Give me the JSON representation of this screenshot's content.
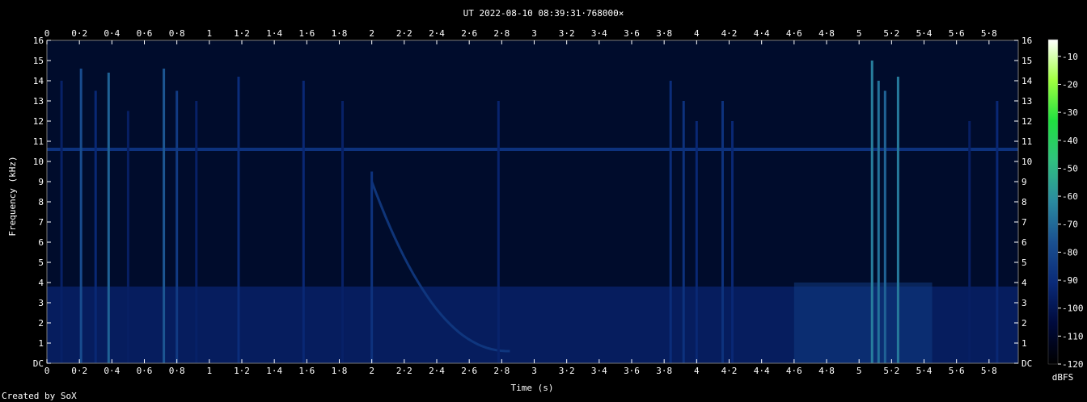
{
  "chart_data": {
    "type": "heatmap",
    "title": "UT 2022-08-10 08:39:31·768000×",
    "xlabel": "Time (s)",
    "ylabel": "Frequency (kHz)",
    "xlim": [
      0,
      5.98
    ],
    "ylim": [
      0,
      16
    ],
    "x_ticks": [
      "0",
      "0·2",
      "0·4",
      "0·6",
      "0·8",
      "1",
      "1·2",
      "1·4",
      "1·6",
      "1·8",
      "2",
      "2·2",
      "2·4",
      "2·6",
      "2·8",
      "3",
      "3·2",
      "3·4",
      "3·6",
      "3·8",
      "4",
      "4·2",
      "4·4",
      "4·6",
      "4·8",
      "5",
      "5·2",
      "5·4",
      "5·6",
      "5·8"
    ],
    "y_ticks": [
      "DC",
      "1",
      "2",
      "3",
      "4",
      "5",
      "6",
      "7",
      "8",
      "9",
      "10",
      "11",
      "12",
      "13",
      "14",
      "15",
      "16"
    ],
    "colorbar": {
      "label": "dBFS",
      "ticks": [
        "-10",
        "-20",
        "-30",
        "-40",
        "-50",
        "-60",
        "-70",
        "-80",
        "-90",
        "-100",
        "-110",
        "-120"
      ],
      "range": [
        -120,
        -4
      ],
      "colors": [
        "#000000",
        "#000a3c",
        "#0a2a78",
        "#1a5090",
        "#2a8aa0",
        "#30c080",
        "#20e040",
        "#a0ff40",
        "#ffffff"
      ]
    },
    "background_level_db": -105,
    "features": [
      {
        "kind": "constant_tone",
        "freq_khz": 10.6,
        "level_db": -88
      },
      {
        "kind": "low_band_energy",
        "freq_range_khz": [
          0,
          3.8
        ],
        "level_db": -95
      },
      {
        "kind": "descending_sweep",
        "t_start": 2.0,
        "t_end": 2.85,
        "f_start_khz": 9.0,
        "f_end_khz": 0.6,
        "level_db": -85
      },
      {
        "kind": "broadband_patch",
        "t_range": [
          4.6,
          5.45
        ],
        "freq_range_khz": [
          0,
          4.0
        ],
        "level_db": -85
      }
    ],
    "impulses": [
      {
        "t": 0.09,
        "fmax_khz": 14.0,
        "level_db": -95
      },
      {
        "t": 0.21,
        "fmax_khz": 14.6,
        "level_db": -78
      },
      {
        "t": 0.3,
        "fmax_khz": 13.5,
        "level_db": -92
      },
      {
        "t": 0.38,
        "fmax_khz": 14.4,
        "level_db": -72
      },
      {
        "t": 0.5,
        "fmax_khz": 12.5,
        "level_db": -96
      },
      {
        "t": 0.72,
        "fmax_khz": 14.6,
        "level_db": -75
      },
      {
        "t": 0.8,
        "fmax_khz": 13.5,
        "level_db": -85
      },
      {
        "t": 0.92,
        "fmax_khz": 13.0,
        "level_db": -95
      },
      {
        "t": 1.18,
        "fmax_khz": 14.2,
        "level_db": -90
      },
      {
        "t": 1.58,
        "fmax_khz": 14.0,
        "level_db": -92
      },
      {
        "t": 1.82,
        "fmax_khz": 13.0,
        "level_db": -95
      },
      {
        "t": 2.0,
        "fmax_khz": 9.5,
        "level_db": -88
      },
      {
        "t": 2.78,
        "fmax_khz": 13.0,
        "level_db": -94
      },
      {
        "t": 3.84,
        "fmax_khz": 14.0,
        "level_db": -90
      },
      {
        "t": 3.92,
        "fmax_khz": 13.0,
        "level_db": -88
      },
      {
        "t": 4.0,
        "fmax_khz": 12.0,
        "level_db": -92
      },
      {
        "t": 4.16,
        "fmax_khz": 13.0,
        "level_db": -88
      },
      {
        "t": 4.22,
        "fmax_khz": 12.0,
        "level_db": -92
      },
      {
        "t": 5.08,
        "fmax_khz": 15.0,
        "level_db": -65
      },
      {
        "t": 5.12,
        "fmax_khz": 14.0,
        "level_db": -68
      },
      {
        "t": 5.16,
        "fmax_khz": 13.5,
        "level_db": -72
      },
      {
        "t": 5.24,
        "fmax_khz": 14.2,
        "level_db": -66
      },
      {
        "t": 5.68,
        "fmax_khz": 12.0,
        "level_db": -96
      },
      {
        "t": 5.85,
        "fmax_khz": 13.0,
        "level_db": -92
      }
    ]
  },
  "footer": {
    "credit": "Created by SoX"
  }
}
